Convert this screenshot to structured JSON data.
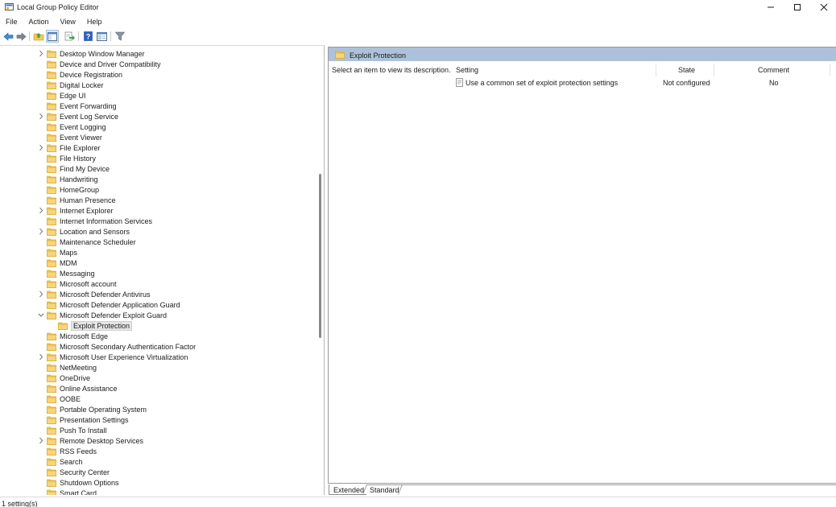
{
  "window": {
    "title": "Local Group Policy Editor"
  },
  "menu": [
    "File",
    "Action",
    "View",
    "Help"
  ],
  "toolbar": {
    "icons": [
      "back-arrow-icon",
      "forward-arrow-icon",
      "up-folder-icon",
      "show-hide-tree-icon",
      "export-list-icon",
      "help-icon",
      "properties-icon",
      "filter-icon"
    ]
  },
  "tree": {
    "items": [
      {
        "label": "Desktop Window Manager",
        "expandable": true
      },
      {
        "label": "Device and Driver Compatibility",
        "expandable": false
      },
      {
        "label": "Device Registration",
        "expandable": false
      },
      {
        "label": "Digital Locker",
        "expandable": false
      },
      {
        "label": "Edge UI",
        "expandable": false
      },
      {
        "label": "Event Forwarding",
        "expandable": false
      },
      {
        "label": "Event Log Service",
        "expandable": true
      },
      {
        "label": "Event Logging",
        "expandable": false
      },
      {
        "label": "Event Viewer",
        "expandable": false
      },
      {
        "label": "File Explorer",
        "expandable": true
      },
      {
        "label": "File History",
        "expandable": false
      },
      {
        "label": "Find My Device",
        "expandable": false
      },
      {
        "label": "Handwriting",
        "expandable": false
      },
      {
        "label": "HomeGroup",
        "expandable": false
      },
      {
        "label": "Human Presence",
        "expandable": false
      },
      {
        "label": "Internet Explorer",
        "expandable": true
      },
      {
        "label": "Internet Information Services",
        "expandable": false
      },
      {
        "label": "Location and Sensors",
        "expandable": true
      },
      {
        "label": "Maintenance Scheduler",
        "expandable": false
      },
      {
        "label": "Maps",
        "expandable": false
      },
      {
        "label": "MDM",
        "expandable": false
      },
      {
        "label": "Messaging",
        "expandable": false
      },
      {
        "label": "Microsoft account",
        "expandable": false
      },
      {
        "label": "Microsoft Defender Antivirus",
        "expandable": true
      },
      {
        "label": "Microsoft Defender Application Guard",
        "expandable": false
      },
      {
        "label": "Microsoft Defender Exploit Guard",
        "expandable": true,
        "expanded": true
      },
      {
        "label": "Exploit Protection",
        "expandable": false,
        "child": true,
        "selected": true
      },
      {
        "label": "Microsoft Edge",
        "expandable": false
      },
      {
        "label": "Microsoft Secondary Authentication Factor",
        "expandable": false
      },
      {
        "label": "Microsoft User Experience Virtualization",
        "expandable": true
      },
      {
        "label": "NetMeeting",
        "expandable": false
      },
      {
        "label": "OneDrive",
        "expandable": false
      },
      {
        "label": "Online Assistance",
        "expandable": false
      },
      {
        "label": "OOBE",
        "expandable": false
      },
      {
        "label": "Portable Operating System",
        "expandable": false
      },
      {
        "label": "Presentation Settings",
        "expandable": false
      },
      {
        "label": "Push To Install",
        "expandable": false
      },
      {
        "label": "Remote Desktop Services",
        "expandable": true
      },
      {
        "label": "RSS Feeds",
        "expandable": false
      },
      {
        "label": "Search",
        "expandable": false
      },
      {
        "label": "Security Center",
        "expandable": false
      },
      {
        "label": "Shutdown Options",
        "expandable": false
      },
      {
        "label": "Smart Card",
        "expandable": false
      }
    ]
  },
  "details": {
    "header_title": "Exploit Protection",
    "description": "Select an item to view its description.",
    "columns": {
      "setting": "Setting",
      "state": "State",
      "comment": "Comment"
    },
    "rows": [
      {
        "setting": "Use a common set of exploit protection settings",
        "state": "Not configured",
        "comment": "No"
      }
    ]
  },
  "tabs": {
    "extended": "Extended",
    "standard": "Standard"
  },
  "status": {
    "text": "1 setting(s)"
  },
  "colors": {
    "header_band": "#adc2da",
    "folder": "#f3c857",
    "folder_dark": "#dba935"
  }
}
